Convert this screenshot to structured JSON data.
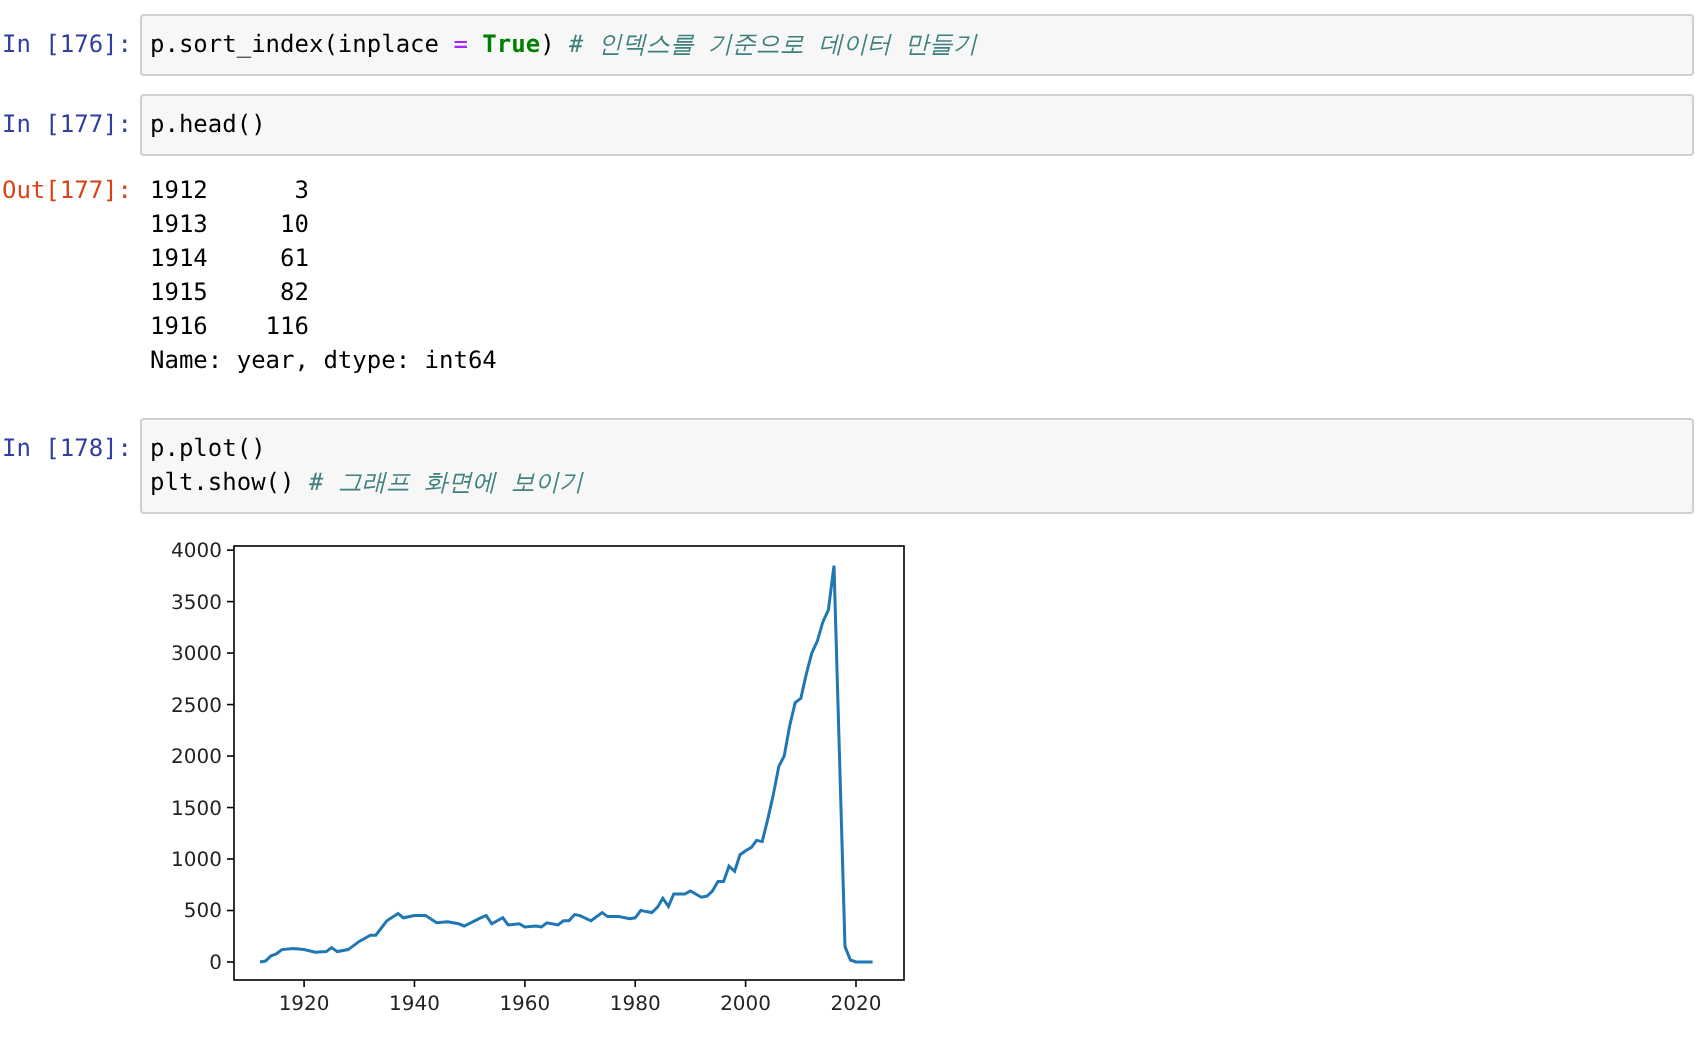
{
  "cells": [
    {
      "kind": "code",
      "prompt": "In [176]:",
      "lines": [
        [
          {
            "kind": "plain",
            "text": "p.sort_index(inplace "
          },
          {
            "kind": "operator",
            "text": "= "
          },
          {
            "kind": "keyword",
            "text": "True"
          },
          {
            "kind": "plain",
            "text": ") "
          },
          {
            "kind": "comment",
            "text": "# 인덱스를 기준으로 데이터 만들기"
          }
        ]
      ]
    },
    {
      "kind": "code",
      "prompt": "In [177]:",
      "lines": [
        [
          {
            "kind": "plain",
            "text": "p.head()"
          }
        ]
      ]
    },
    {
      "kind": "output",
      "prompt": "Out[177]:",
      "lines": [
        "1912      3",
        "1913     10",
        "1914     61",
        "1915     82",
        "1916    116",
        "Name: year, dtype: int64"
      ]
    },
    {
      "kind": "code",
      "prompt": "In [178]:",
      "lines": [
        [
          {
            "kind": "plain",
            "text": "p.plot()"
          }
        ],
        [
          {
            "kind": "plain",
            "text": "plt.show() "
          },
          {
            "kind": "comment",
            "text": "# 그래프 화면에 보이기"
          }
        ]
      ]
    },
    {
      "kind": "chart",
      "chart_data": {
        "type": "line",
        "xlim": [
          1907.3,
          2028.7
        ],
        "ylim": [
          -175,
          4040
        ],
        "xticks": [
          1920,
          1940,
          1960,
          1980,
          2000,
          2020
        ],
        "yticks": [
          0,
          500,
          1000,
          1500,
          2000,
          2500,
          3000,
          3500,
          4000
        ],
        "x": [
          1912,
          1913,
          1914,
          1915,
          1916,
          1918,
          1920,
          1922,
          1924,
          1925,
          1926,
          1928,
          1930,
          1932,
          1933,
          1935,
          1937,
          1938,
          1940,
          1942,
          1944,
          1946,
          1948,
          1949,
          1952,
          1953,
          1954,
          1956,
          1957,
          1959,
          1960,
          1962,
          1963,
          1964,
          1966,
          1967,
          1968,
          1969,
          1970,
          1972,
          1974,
          1975,
          1977,
          1979,
          1980,
          1981,
          1982,
          1983,
          1984,
          1985,
          1986,
          1987,
          1989,
          1990,
          1992,
          1993,
          1994,
          1995,
          1996,
          1997,
          1998,
          1999,
          2000,
          2001,
          2002,
          2003,
          2004,
          2005,
          2006,
          2007,
          2008,
          2009,
          2010,
          2011,
          2012,
          2013,
          2014,
          2015,
          2016,
          2018,
          2019,
          2020,
          2023
        ],
        "series": [
          {
            "color": "#1f77b4",
            "values": [
              0,
              10,
              60,
              80,
              120,
              130,
              120,
              95,
              100,
              140,
              100,
              120,
              200,
              260,
              260,
              400,
              470,
              430,
              450,
              450,
              380,
              390,
              370,
              350,
              430,
              450,
              370,
              430,
              360,
              370,
              340,
              350,
              340,
              380,
              360,
              400,
              400,
              460,
              450,
              400,
              480,
              440,
              440,
              420,
              430,
              500,
              490,
              480,
              530,
              620,
              540,
              660,
              660,
              690,
              630,
              640,
              690,
              780,
              780,
              930,
              880,
              1040,
              1080,
              1110,
              1180,
              1170,
              1380,
              1620,
              1900,
              2000,
              2300,
              2520,
              2560,
              2800,
              3000,
              3120,
              3300,
              3420,
              3850,
              150,
              20,
              0,
              0
            ]
          }
        ]
      }
    }
  ]
}
